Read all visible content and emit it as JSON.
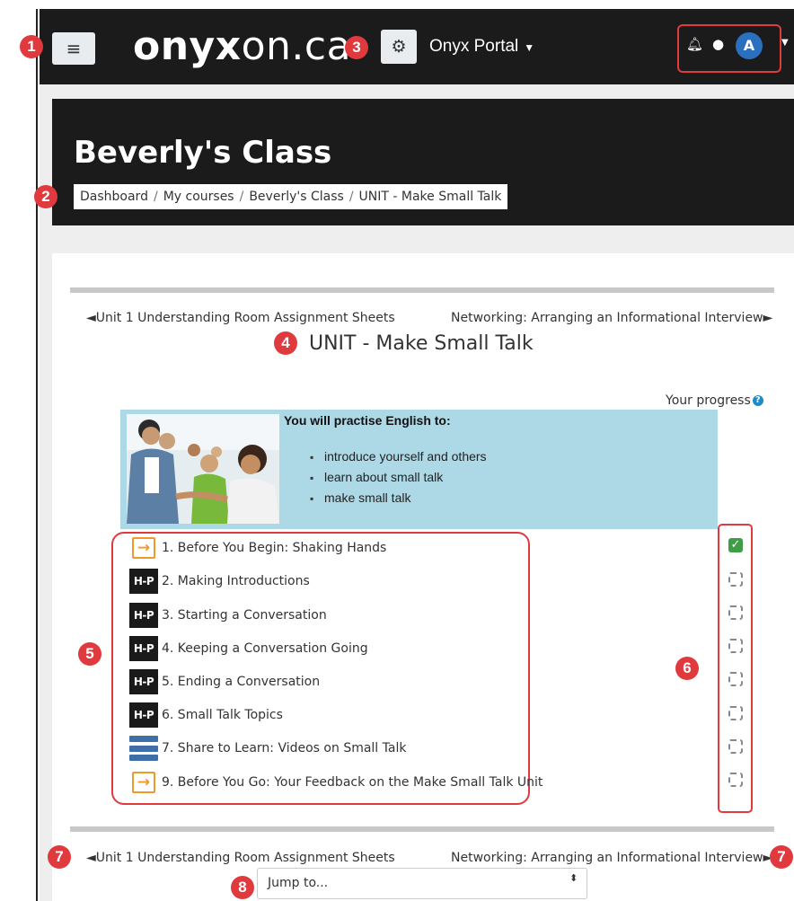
{
  "navbar": {
    "menu_icon": "hamburger-icon",
    "logo_bold": "onyx",
    "logo_rest": "on.ca",
    "settings_icon": "cogs-icon",
    "portal_label": "Onyx Portal",
    "notification_icon": "bell-icon",
    "message_icon": "chat-icon",
    "avatar_icon": "user-avatar-icon"
  },
  "header": {
    "course_title": "Beverly's Class",
    "breadcrumb": [
      "Dashboard",
      "My courses",
      "Beverly's Class",
      "UNIT - Make Small Talk"
    ]
  },
  "section": {
    "prev_link": "Unit 1 Understanding Room Assignment Sheets",
    "next_link": "Networking: Arranging an Informational Interview",
    "prev_arrow": "◄",
    "next_arrow": "►",
    "title": "UNIT - Make Small Talk",
    "progress_label": "Your progress",
    "help_icon": "?"
  },
  "info": {
    "heading": "You will practise English to:",
    "items": [
      "introduce yourself and others",
      "learn about small talk",
      "make small talk"
    ]
  },
  "activities": [
    {
      "label": "1. Before You Begin: Shaking Hands",
      "icon": "arrow-right-icon",
      "completed": true
    },
    {
      "label": "2. Making Introductions",
      "icon": "h5p-icon",
      "completed": false
    },
    {
      "label": "3. Starting a Conversation",
      "icon": "h5p-icon",
      "completed": false
    },
    {
      "label": "4. Keeping a Conversation Going",
      "icon": "h5p-icon",
      "completed": false
    },
    {
      "label": "5. Ending a Conversation",
      "icon": "h5p-icon",
      "completed": false
    },
    {
      "label": "6. Small Talk Topics",
      "icon": "h5p-icon",
      "completed": false
    },
    {
      "label": "7. Share to Learn: Videos on Small Talk",
      "icon": "database-icon",
      "completed": false
    },
    {
      "label": "9. Before You Go: Your Feedback on the Make Small Talk Unit",
      "icon": "arrow-right-icon",
      "completed": false
    }
  ],
  "h5p_text": "H-P",
  "jump": {
    "placeholder": "Jump to...",
    "caret": "⬍"
  },
  "annotations": [
    "1",
    "2",
    "3",
    "4",
    "5",
    "6",
    "7",
    "8"
  ],
  "colors": {
    "annotation_red": "#e03a3e",
    "navbar": "#1b1b1b",
    "info_box": "#add8e6",
    "complete_green": "#3f9d46",
    "arrow_orange": "#f0982a"
  }
}
